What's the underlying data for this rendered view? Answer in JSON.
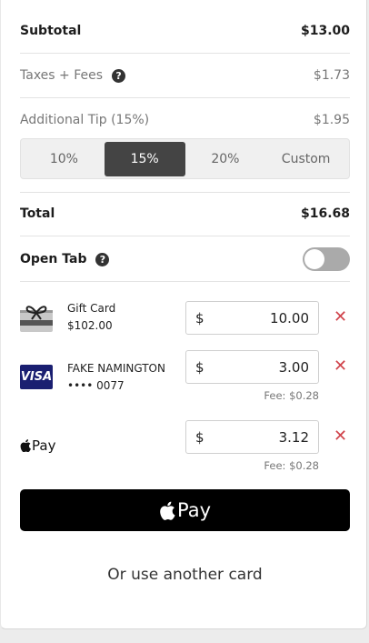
{
  "summary": {
    "subtotal_label": "Subtotal",
    "subtotal_value": "$13.00",
    "taxes_label": "Taxes + Fees",
    "taxes_value": "$1.73",
    "tip_label": "Additional Tip (15%)",
    "tip_value": "$1.95",
    "total_label": "Total",
    "total_value": "$16.68"
  },
  "tip_options": [
    "10%",
    "15%",
    "20%",
    "Custom"
  ],
  "tip_selected": "15%",
  "open_tab": {
    "label": "Open Tab",
    "enabled": false
  },
  "payments": {
    "gift": {
      "title": "Gift Card",
      "subtitle": "$102.00",
      "currency": "$",
      "amount": "10.00"
    },
    "card": {
      "brand": "VISA",
      "title": "FAKE NAMINGTON",
      "subtitle": "•••• 0077",
      "currency": "$",
      "amount": "3.00",
      "fee": "Fee: $0.28"
    },
    "applepay": {
      "label": "Pay",
      "currency": "$",
      "amount": "3.12",
      "fee": "Fee: $0.28"
    }
  },
  "buttons": {
    "applepay_label": "Pay",
    "other_card": "Or use another card"
  },
  "colors": {
    "remove": "#d0434b",
    "visa": "#1a1f71",
    "toggle_off": "#aaaaaa"
  },
  "icons": {
    "help": "question-circle-icon",
    "gift": "gift-card-icon",
    "card": "visa-icon",
    "apple": "apple-icon",
    "remove": "close-icon"
  }
}
